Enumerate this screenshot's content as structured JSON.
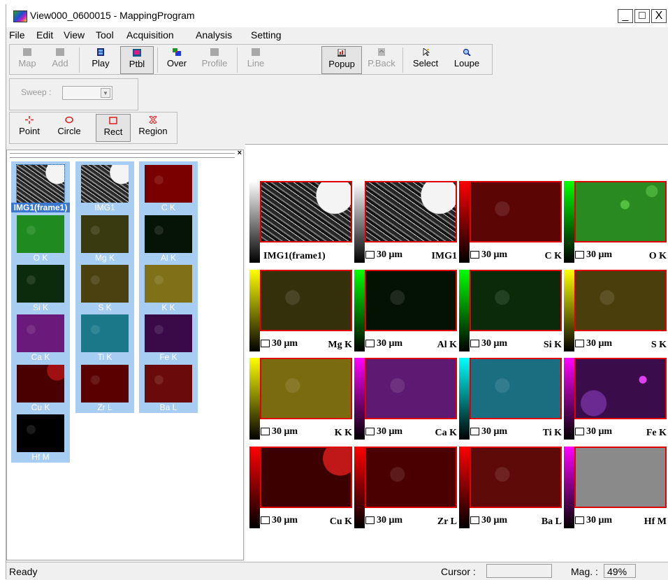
{
  "window": {
    "title": "View000_0600015 - MappingProgram",
    "minimize_glyph": "_",
    "maximize_glyph": "□",
    "close_glyph": "X"
  },
  "menu": [
    "File",
    "Edit",
    "View",
    "Tool",
    "Acquisition",
    "Analysis",
    "Setting"
  ],
  "toolbar": {
    "map_label": "Map",
    "add_label": "Add",
    "play_label": "Play",
    "ptbl_label": "Ptbl",
    "over_label": "Over",
    "profile_label": "Profile",
    "line_label": "Line",
    "popup_label": "Popup",
    "pback_label": "P.Back",
    "select_label": "Select",
    "loupe_label": "Loupe",
    "sweep_label": "Sweep :",
    "point_label": "Point",
    "circle_label": "Circle",
    "rect_label": "Rect",
    "region_label": "Region"
  },
  "thumbnails": [
    {
      "label": "IMG1(frame1)",
      "kind": "sem"
    },
    {
      "label": "IMG1",
      "kind": "sem"
    },
    {
      "label": "C K",
      "color": "#7a0000"
    },
    {
      "label": "O K",
      "color": "#1f8a1f"
    },
    {
      "label": "Mg K",
      "color": "#3a3a10"
    },
    {
      "label": "Al K",
      "color": "#061406"
    },
    {
      "label": "Si K",
      "color": "#0c2a0c"
    },
    {
      "label": "S K",
      "color": "#4a4010"
    },
    {
      "label": "K K",
      "color": "#807018"
    },
    {
      "label": "Ca K",
      "color": "#6a1a7a"
    },
    {
      "label": "Ti K",
      "color": "#1a7888"
    },
    {
      "label": "Fe K",
      "color": "#3a0a48"
    },
    {
      "label": "Cu K",
      "color": "#4a0000"
    },
    {
      "label": "Zr L",
      "color": "#5a0000"
    },
    {
      "label": "Ba L",
      "color": "#6a0a0a"
    },
    {
      "label": "Hf M",
      "color": "#000000"
    }
  ],
  "tiles": [
    {
      "name": "IMG1(frame1)",
      "scale": "",
      "kind": "sem",
      "bar_top": "#ffffff",
      "bar_bottom": "#000000"
    },
    {
      "name": "IMG1",
      "scale": "30 μm",
      "kind": "sem",
      "bar_top": "#ffffff",
      "bar_bottom": "#000000"
    },
    {
      "name": "C K",
      "scale": "30 μm",
      "color": "#5c0505",
      "bar_top": "#ff0000",
      "bar_bottom": "#000000"
    },
    {
      "name": "O K",
      "scale": "30 μm",
      "color": "#2a8a22",
      "bar_top": "#00ff00",
      "bar_bottom": "#000000"
    },
    {
      "name": "Mg K",
      "scale": "30 μm",
      "color": "#34300c",
      "bar_top": "#ffff00",
      "bar_bottom": "#000000"
    },
    {
      "name": "Al K",
      "scale": "30 μm",
      "color": "#041204",
      "bar_top": "#00ff00",
      "bar_bottom": "#000000"
    },
    {
      "name": "Si K",
      "scale": "30 μm",
      "color": "#0a2a0a",
      "bar_top": "#00ff00",
      "bar_bottom": "#000000"
    },
    {
      "name": "S K",
      "scale": "30 μm",
      "color": "#4a3e0c",
      "bar_top": "#ffff00",
      "bar_bottom": "#000000"
    },
    {
      "name": "K K",
      "scale": "30 μm",
      "color": "#7a6a10",
      "bar_top": "#ffff00",
      "bar_bottom": "#000000"
    },
    {
      "name": "Ca K",
      "scale": "30 μm",
      "color": "#5e1a72",
      "bar_top": "#ff00ff",
      "bar_bottom": "#000000"
    },
    {
      "name": "Ti K",
      "scale": "30 μm",
      "color": "#1a6e80",
      "bar_top": "#00ffff",
      "bar_bottom": "#000000"
    },
    {
      "name": "Fe K",
      "scale": "30 μm",
      "color": "#3a0c4a",
      "bar_top": "#ff00ff",
      "bar_bottom": "#000000"
    },
    {
      "name": "Cu K",
      "scale": "30 μm",
      "color": "#3c0000",
      "bar_top": "#ff0000",
      "bar_bottom": "#000000"
    },
    {
      "name": "Zr L",
      "scale": "30 μm",
      "color": "#4a0000",
      "bar_top": "#ff0000",
      "bar_bottom": "#000000"
    },
    {
      "name": "Ba L",
      "scale": "30 μm",
      "color": "#5e0a08",
      "bar_top": "#ff0000",
      "bar_bottom": "#000000"
    },
    {
      "name": "Hf M",
      "scale": "30 μm",
      "color": "#8a8a8a",
      "bar_top": "#ff00ff",
      "bar_bottom": "#000000"
    }
  ],
  "status": {
    "ready": "Ready",
    "cursor_label": "Cursor :",
    "cursor_value": "",
    "mag_label": "Mag. :",
    "mag_value": "49%"
  }
}
